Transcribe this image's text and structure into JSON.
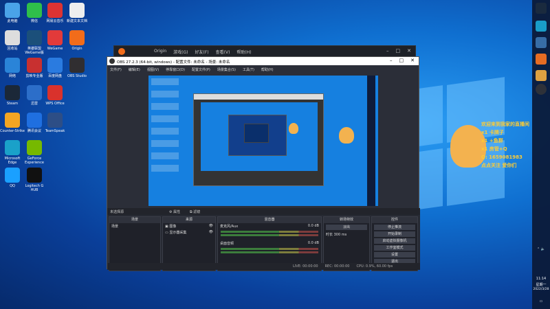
{
  "desktop_icons": [
    {
      "label": "此电脑",
      "color": "#4aa3e8"
    },
    {
      "label": "微信",
      "color": "#2fbf4a"
    },
    {
      "label": "网易云音乐",
      "color": "#d33"
    },
    {
      "label": "新建文本文档",
      "color": "#eee"
    },
    {
      "label": "回收站",
      "color": "#ddd"
    },
    {
      "label": "英雄联盟WeGame版",
      "color": "#1b4f7a"
    },
    {
      "label": "WeGame",
      "color": "#e23a3a"
    },
    {
      "label": "Origin",
      "color": "#f26c1a"
    },
    {
      "label": "网络",
      "color": "#2a84d8"
    },
    {
      "label": "剪映专业版",
      "color": "#c83030"
    },
    {
      "label": "百度网盘",
      "color": "#2a7be0"
    },
    {
      "label": "Steam",
      "color": "#1b2838"
    },
    {
      "label": "迅雷",
      "color": "#2c6ec9"
    },
    {
      "label": "Counter-Strike",
      "color": "#f4a523"
    },
    {
      "label": "腾讯会议",
      "color": "#1f6fe0"
    },
    {
      "label": "WPS Office",
      "color": "#d9322c"
    },
    {
      "label": "OBS Studio",
      "color": "#302e31"
    },
    {
      "label": "Microsoft Edge",
      "color": "#1aa1c9"
    },
    {
      "label": "GeForce Experience",
      "color": "#76b900"
    },
    {
      "label": "TeamSpeak",
      "color": "#2d4e86"
    },
    {
      "label": "QQ",
      "color": "#1aa0ff"
    },
    {
      "label": "Logitech G HUB",
      "color": "#111"
    }
  ],
  "origin": {
    "title": "Origin",
    "menu": [
      "Origin",
      "游戏(G)",
      "好友(F)",
      "查看(V)",
      "帮助(H)"
    ]
  },
  "obs": {
    "title": "OBS 27.2.3 (64-bit, windows) - 配置文件: 未命名 - 场景: 未命名",
    "menu": [
      "文件(F)",
      "编辑(E)",
      "视图(V)",
      "停靠窗口(D)",
      "配置文件(P)",
      "场景集合(S)",
      "工具(T)",
      "帮助(H)"
    ],
    "source_bar": "未选择源",
    "source_buttons": [
      "属性",
      "滤镜"
    ],
    "panels": {
      "scenes": {
        "header": "场景",
        "items": [
          "场景"
        ]
      },
      "sources": {
        "header": "来源",
        "items": [
          "图像",
          "显示器采集"
        ]
      },
      "mixer": {
        "header": "混音器",
        "tracks": [
          {
            "name": "麦克风/Aux",
            "db": "0.0 dB"
          },
          {
            "name": "桌面音频",
            "db": "0.0 dB"
          }
        ]
      },
      "transitions": {
        "header": "转场特效",
        "type": "淡出",
        "duration_label": "时长",
        "duration": "300 ms"
      },
      "controls": {
        "header": "控件",
        "buttons": [
          "停止推流",
          "开始录制",
          "启动虚拟摄像机",
          "工作室模式",
          "设置",
          "退出"
        ]
      }
    },
    "status": [
      "LIVE: 00:00:00",
      "REC: 00:00:00",
      "CPU: 0.9%, 60.00 fps"
    ]
  },
  "overlay": {
    "lines": [
      "欢迎来到我家的直播间",
      "x1 卡牌子",
      "x1 +鱼群",
      "x1 房管+Q",
      "Q: 1659081983",
      "点点关注 爱你们"
    ],
    "color": "#ffcc33"
  },
  "taskbar": {
    "time": "11:14",
    "weekday": "星期一",
    "date": "2022/3/28"
  }
}
